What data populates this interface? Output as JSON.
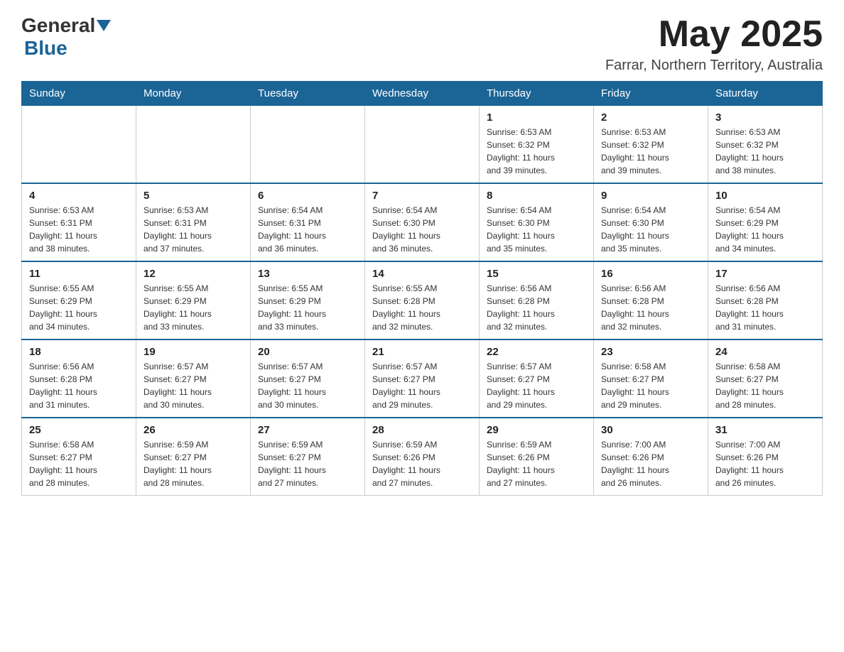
{
  "header": {
    "logo_general": "General",
    "logo_blue": "Blue",
    "month_title": "May 2025",
    "location": "Farrar, Northern Territory, Australia"
  },
  "weekdays": [
    "Sunday",
    "Monday",
    "Tuesday",
    "Wednesday",
    "Thursday",
    "Friday",
    "Saturday"
  ],
  "weeks": [
    [
      {
        "day": "",
        "info": ""
      },
      {
        "day": "",
        "info": ""
      },
      {
        "day": "",
        "info": ""
      },
      {
        "day": "",
        "info": ""
      },
      {
        "day": "1",
        "info": "Sunrise: 6:53 AM\nSunset: 6:32 PM\nDaylight: 11 hours\nand 39 minutes."
      },
      {
        "day": "2",
        "info": "Sunrise: 6:53 AM\nSunset: 6:32 PM\nDaylight: 11 hours\nand 39 minutes."
      },
      {
        "day": "3",
        "info": "Sunrise: 6:53 AM\nSunset: 6:32 PM\nDaylight: 11 hours\nand 38 minutes."
      }
    ],
    [
      {
        "day": "4",
        "info": "Sunrise: 6:53 AM\nSunset: 6:31 PM\nDaylight: 11 hours\nand 38 minutes."
      },
      {
        "day": "5",
        "info": "Sunrise: 6:53 AM\nSunset: 6:31 PM\nDaylight: 11 hours\nand 37 minutes."
      },
      {
        "day": "6",
        "info": "Sunrise: 6:54 AM\nSunset: 6:31 PM\nDaylight: 11 hours\nand 36 minutes."
      },
      {
        "day": "7",
        "info": "Sunrise: 6:54 AM\nSunset: 6:30 PM\nDaylight: 11 hours\nand 36 minutes."
      },
      {
        "day": "8",
        "info": "Sunrise: 6:54 AM\nSunset: 6:30 PM\nDaylight: 11 hours\nand 35 minutes."
      },
      {
        "day": "9",
        "info": "Sunrise: 6:54 AM\nSunset: 6:30 PM\nDaylight: 11 hours\nand 35 minutes."
      },
      {
        "day": "10",
        "info": "Sunrise: 6:54 AM\nSunset: 6:29 PM\nDaylight: 11 hours\nand 34 minutes."
      }
    ],
    [
      {
        "day": "11",
        "info": "Sunrise: 6:55 AM\nSunset: 6:29 PM\nDaylight: 11 hours\nand 34 minutes."
      },
      {
        "day": "12",
        "info": "Sunrise: 6:55 AM\nSunset: 6:29 PM\nDaylight: 11 hours\nand 33 minutes."
      },
      {
        "day": "13",
        "info": "Sunrise: 6:55 AM\nSunset: 6:29 PM\nDaylight: 11 hours\nand 33 minutes."
      },
      {
        "day": "14",
        "info": "Sunrise: 6:55 AM\nSunset: 6:28 PM\nDaylight: 11 hours\nand 32 minutes."
      },
      {
        "day": "15",
        "info": "Sunrise: 6:56 AM\nSunset: 6:28 PM\nDaylight: 11 hours\nand 32 minutes."
      },
      {
        "day": "16",
        "info": "Sunrise: 6:56 AM\nSunset: 6:28 PM\nDaylight: 11 hours\nand 32 minutes."
      },
      {
        "day": "17",
        "info": "Sunrise: 6:56 AM\nSunset: 6:28 PM\nDaylight: 11 hours\nand 31 minutes."
      }
    ],
    [
      {
        "day": "18",
        "info": "Sunrise: 6:56 AM\nSunset: 6:28 PM\nDaylight: 11 hours\nand 31 minutes."
      },
      {
        "day": "19",
        "info": "Sunrise: 6:57 AM\nSunset: 6:27 PM\nDaylight: 11 hours\nand 30 minutes."
      },
      {
        "day": "20",
        "info": "Sunrise: 6:57 AM\nSunset: 6:27 PM\nDaylight: 11 hours\nand 30 minutes."
      },
      {
        "day": "21",
        "info": "Sunrise: 6:57 AM\nSunset: 6:27 PM\nDaylight: 11 hours\nand 29 minutes."
      },
      {
        "day": "22",
        "info": "Sunrise: 6:57 AM\nSunset: 6:27 PM\nDaylight: 11 hours\nand 29 minutes."
      },
      {
        "day": "23",
        "info": "Sunrise: 6:58 AM\nSunset: 6:27 PM\nDaylight: 11 hours\nand 29 minutes."
      },
      {
        "day": "24",
        "info": "Sunrise: 6:58 AM\nSunset: 6:27 PM\nDaylight: 11 hours\nand 28 minutes."
      }
    ],
    [
      {
        "day": "25",
        "info": "Sunrise: 6:58 AM\nSunset: 6:27 PM\nDaylight: 11 hours\nand 28 minutes."
      },
      {
        "day": "26",
        "info": "Sunrise: 6:59 AM\nSunset: 6:27 PM\nDaylight: 11 hours\nand 28 minutes."
      },
      {
        "day": "27",
        "info": "Sunrise: 6:59 AM\nSunset: 6:27 PM\nDaylight: 11 hours\nand 27 minutes."
      },
      {
        "day": "28",
        "info": "Sunrise: 6:59 AM\nSunset: 6:26 PM\nDaylight: 11 hours\nand 27 minutes."
      },
      {
        "day": "29",
        "info": "Sunrise: 6:59 AM\nSunset: 6:26 PM\nDaylight: 11 hours\nand 27 minutes."
      },
      {
        "day": "30",
        "info": "Sunrise: 7:00 AM\nSunset: 6:26 PM\nDaylight: 11 hours\nand 26 minutes."
      },
      {
        "day": "31",
        "info": "Sunrise: 7:00 AM\nSunset: 6:26 PM\nDaylight: 11 hours\nand 26 minutes."
      }
    ]
  ]
}
